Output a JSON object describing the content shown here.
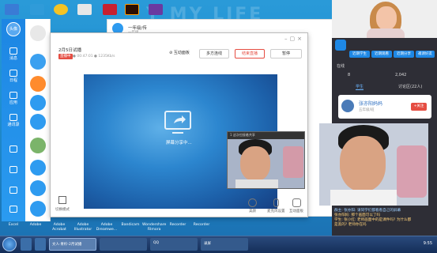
{
  "desktop": {
    "background_text": "Y  MY  LIFE",
    "labels": [
      "Excel",
      "Adobe",
      "Adobe Acrobat",
      "Adobe Illustrator",
      "Adobe Dreamwe...",
      "Bandicam",
      "Wondershare Filmora",
      "Recorder",
      "Recorder"
    ]
  },
  "qq": {
    "avatar_label": "头像",
    "sidebar": [
      "消息",
      "日程",
      "应用",
      "通讯录"
    ],
    "header_title": "一年级/传",
    "header_sub": "一年级"
  },
  "window": {
    "title": "2月5日试播",
    "live_badge": "直播中",
    "stats": "● 00:47:01  ● 1235Kb/s",
    "toolbar": {
      "hide_button": "⊘ 互动面板",
      "multi_button": "多方连线",
      "end_live_button": "结束直播",
      "pause_button": "暂停"
    },
    "share_status": "屏幕分享中...",
    "cam_title": "1 这次也接着共享",
    "bottom_left": "切换模式",
    "bottom_tools": [
      "美颜",
      "麦克风设置",
      "互动面板"
    ]
  },
  "teacher_panel": {
    "buttons": [
      "近期学生",
      "近期观看",
      "近期分享",
      "邀请好友"
    ],
    "online_label": "在线",
    "online_count": "8",
    "likes_count": "2,042",
    "tabs": [
      "学生",
      "讨论区(22人)"
    ],
    "host_name": "张亦阳妈妈",
    "host_sub": "五年级/班",
    "host_follow": "+关注",
    "chat": [
      "群主: 张亦阳: 请同学们都看看自己的屏幕",
      "张亦阳妈: 那个画面可以了吗",
      "学生: 张小红: 老师画面中的是课件吗? 为什么都",
      "是黑的? 老师你在吗"
    ]
  },
  "taskbar": {
    "items": [
      "文人·青柠-2月试播",
      "",
      "QQ",
      "录屏"
    ],
    "time": "9:55"
  },
  "colors": {
    "accent": "#1e88e5",
    "live_red": "#e54d42",
    "panel_bg": "#2e2e36"
  }
}
